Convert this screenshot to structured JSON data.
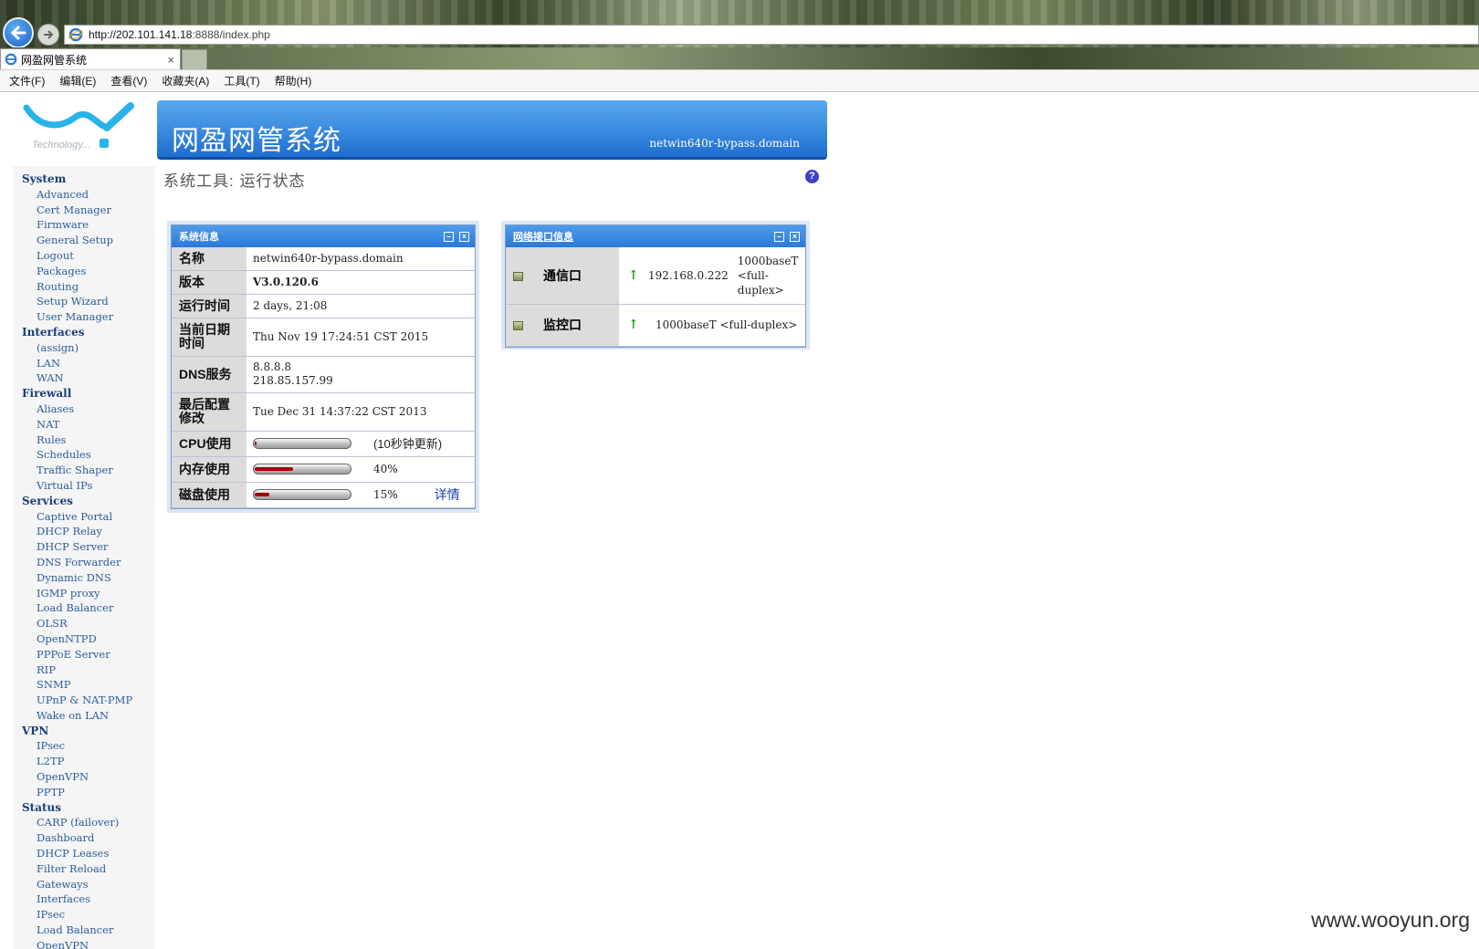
{
  "browser": {
    "address_host": "http://202.101.141.18",
    "address_rest": ":8888/index.php",
    "tab_title": "网盈网管系统",
    "tab_close": "×",
    "menu": [
      "文件(F)",
      "编辑(E)",
      "查看(V)",
      "收藏夹(A)",
      "工具(T)",
      "帮助(H)"
    ]
  },
  "logo": {
    "text": "Technology..."
  },
  "header": {
    "title": "网盈网管系统",
    "hostname": "netwin640r-bypass.domain"
  },
  "sidebar": [
    {
      "section": "System",
      "items": [
        "Advanced",
        "Cert Manager",
        "Firmware",
        "General Setup",
        "Logout",
        "Packages",
        "Routing",
        "Setup Wizard",
        "User Manager"
      ]
    },
    {
      "section": "Interfaces",
      "items": [
        "(assign)",
        "LAN",
        "WAN"
      ]
    },
    {
      "section": "Firewall",
      "items": [
        "Aliases",
        "NAT",
        "Rules",
        "Schedules",
        "Traffic Shaper",
        "Virtual IPs"
      ]
    },
    {
      "section": "Services",
      "items": [
        "Captive Portal",
        "DHCP Relay",
        "DHCP Server",
        "DNS Forwarder",
        "Dynamic DNS",
        "IGMP proxy",
        "Load Balancer",
        "OLSR",
        "OpenNTPD",
        "PPPoE Server",
        "RIP",
        "SNMP",
        "UPnP & NAT-PMP",
        "Wake on LAN"
      ]
    },
    {
      "section": "VPN",
      "items": [
        "IPsec",
        "L2TP",
        "OpenVPN",
        "PPTP"
      ]
    },
    {
      "section": "Status",
      "items": [
        "CARP (failover)",
        "Dashboard",
        "DHCP Leases",
        "Filter Reload",
        "Gateways",
        "Interfaces",
        "IPsec",
        "Load Balancer",
        "OpenVPN"
      ]
    }
  ],
  "page": {
    "title": "系统工具: 运行状态",
    "help": "?"
  },
  "sysinfo": {
    "title": "系统信息",
    "min_btn": "–",
    "close_btn": "×",
    "name_label": "名称",
    "name_value": "netwin640r-bypass.domain",
    "version_label": "版本",
    "version_value": "V3.0.120.6",
    "uptime_label": "运行时间",
    "uptime_value": "2 days, 21:08",
    "datetime_label": "当前日期时间",
    "datetime_value": "Thu Nov 19 17:24:51 CST 2015",
    "dns_label": "DNS服务",
    "dns_1": "8.8.8.8",
    "dns_2": "218.85.157.99",
    "lastcfg_label": "最后配置修改",
    "lastcfg_value": "Tue Dec 31 14:37:22 CST 2013",
    "cpu_label": "CPU使用",
    "cpu_note": "(10秒钟更新)",
    "cpu_percent": 2,
    "mem_label": "内存使用",
    "mem_value": "40%",
    "mem_percent": 40,
    "disk_label": "磁盘使用",
    "disk_value": "15%",
    "disk_percent": 15,
    "disk_link": "详情"
  },
  "netinfo": {
    "title": "网络接口信息",
    "min_btn": "–",
    "close_btn": "×",
    "rows": [
      {
        "name": "通信口",
        "ip": "192.168.0.222",
        "media": "1000baseT <full-duplex>"
      },
      {
        "name": "监控口",
        "ip": "",
        "media": "1000baseT <full-duplex>"
      }
    ]
  },
  "watermark": "www.wooyun.org",
  "colors": {
    "banner": "#2c79d9",
    "bar_fill": "#a40000",
    "link": "#2a5d9c",
    "up_arrow": "#1ca31c"
  }
}
